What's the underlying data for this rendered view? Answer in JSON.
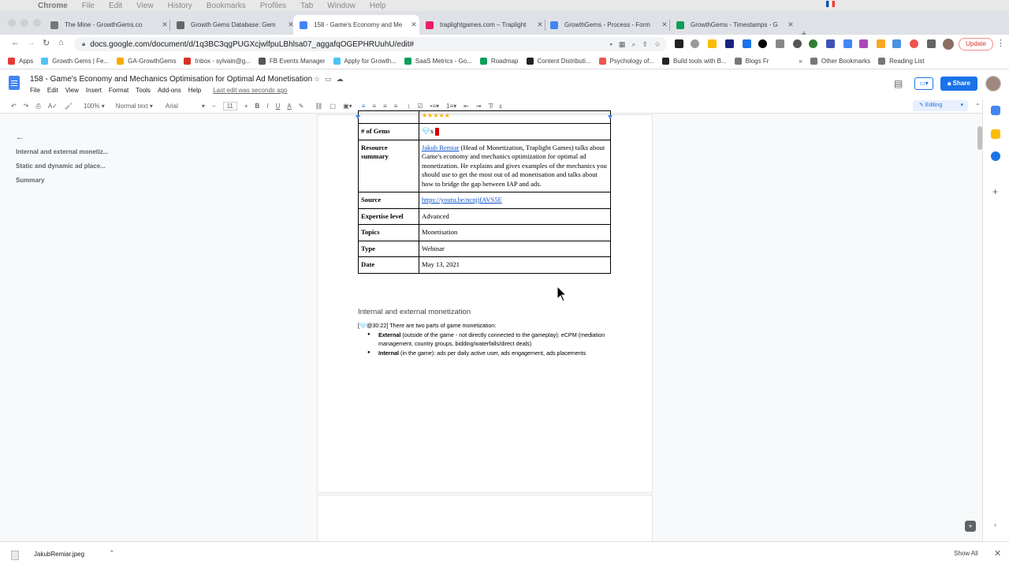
{
  "menubar": {
    "app": "Chrome",
    "items": [
      "File",
      "Edit",
      "View",
      "History",
      "Bookmarks",
      "Profiles",
      "Tab",
      "Window",
      "Help"
    ]
  },
  "tabs": [
    {
      "title": "The Mine - GrowthGems.co",
      "icon": "pickaxe-icon",
      "color": "#555555"
    },
    {
      "title": "Growth Gems Database: Gem",
      "icon": "gg-icon",
      "color": "#555555"
    },
    {
      "title": "158 - Game's Economy and Me",
      "icon": "docs-icon",
      "color": "#4285f4"
    },
    {
      "title": "traplightgames.com – Traplight",
      "icon": "traplight-icon",
      "color": "#e91e63"
    },
    {
      "title": "GrowthGems - Process - Form",
      "icon": "docs-icon",
      "color": "#4285f4"
    },
    {
      "title": "GrowthGems - Timestamps - G",
      "icon": "sheets-icon",
      "color": "#0f9d58"
    }
  ],
  "url": "docs.google.com/document/d/1q3BC3qgPUGXcjwlfpuLBhlsa07_aggafqOGEPHRUuhU/edit#",
  "update_label": "Update",
  "bookmarks": [
    {
      "label": "Apps",
      "color": "#e53935"
    },
    {
      "label": "Growth Gems | Fe...",
      "color": "#4fc3f7"
    },
    {
      "label": "GA-GrowthGems",
      "color": "#f9ab00"
    },
    {
      "label": "Inbox - sylvain@g...",
      "color": "#d93025"
    },
    {
      "label": "FB Events Manager",
      "color": "#555555"
    },
    {
      "label": "Apply for Growth...",
      "color": "#4fc3f7"
    },
    {
      "label": "SaaS Metrics - Go...",
      "color": "#0f9d58"
    },
    {
      "label": "Roadmap",
      "color": "#0f9d58"
    },
    {
      "label": "Content Distributi...",
      "color": "#222222"
    },
    {
      "label": "Psychology of...",
      "color": "#ef5350"
    },
    {
      "label": "Build tools with B...",
      "color": "#222222"
    },
    {
      "label": "Blogs Fr",
      "color": "#777777"
    },
    {
      "label": "Other Bookmarks",
      "color": "#777777"
    },
    {
      "label": "Reading List",
      "color": "#777777"
    }
  ],
  "doc": {
    "title": "158 - Game's Economy and Mechanics Optimisation for Optimal Ad Monetisation",
    "menus": [
      "File",
      "Edit",
      "View",
      "Insert",
      "Format",
      "Tools",
      "Add-ons",
      "Help"
    ],
    "last_edit": "Last edit was seconds ago",
    "share_label": "Share"
  },
  "toolbar": {
    "zoom": "100%",
    "style": "Normal text",
    "font": "Arial",
    "font_size": "11",
    "mode": "Editing"
  },
  "outline": {
    "items": [
      "Internal and external monetiz...",
      "Static and dynamic ad place...",
      "Summary"
    ]
  },
  "table": {
    "gems_label": "# of Gems",
    "gems_value": "x",
    "resource_label": "Resource summary",
    "resource_link": "Jakub Remiar",
    "resource_text": " (Head of Monetization, Traplight Games) talks about Game's economy and mechanics optimization for optimal ad monetization. He explains and gives examples of the mechanics you should use to get the most out of ad monetisation and talks about how to bridge the gap between IAP and ads.",
    "source_label": "Source",
    "source_value": "https://youtu.be/ncnjjfAVS5E",
    "expertise_label": "Expertise level",
    "expertise_value": "Advanced",
    "topics_label": "Topics",
    "topics_value": "Monetisation",
    "type_label": "Type",
    "type_value": "Webinar",
    "date_label": "Date",
    "date_value": "May 13, 2021"
  },
  "section": {
    "heading": "Internal and external monetization",
    "intro_prefix": "[",
    "intro_time": "@30:22]",
    "intro_text": " There are two parts of game monetization:",
    "bullet1_bold": "External",
    "bullet1_text": " (outside of the game - not directly connected to the gameplay): eCPM (mediation management, country groups, bidding/waterfalls/direct deals)",
    "bullet2_bold": "Internal",
    "bullet2_text": " (in the game): ads per daily active user, ads engagement, ads placements"
  },
  "download": {
    "filename": "JakubRemiar.jpeg",
    "show_all": "Show All"
  }
}
